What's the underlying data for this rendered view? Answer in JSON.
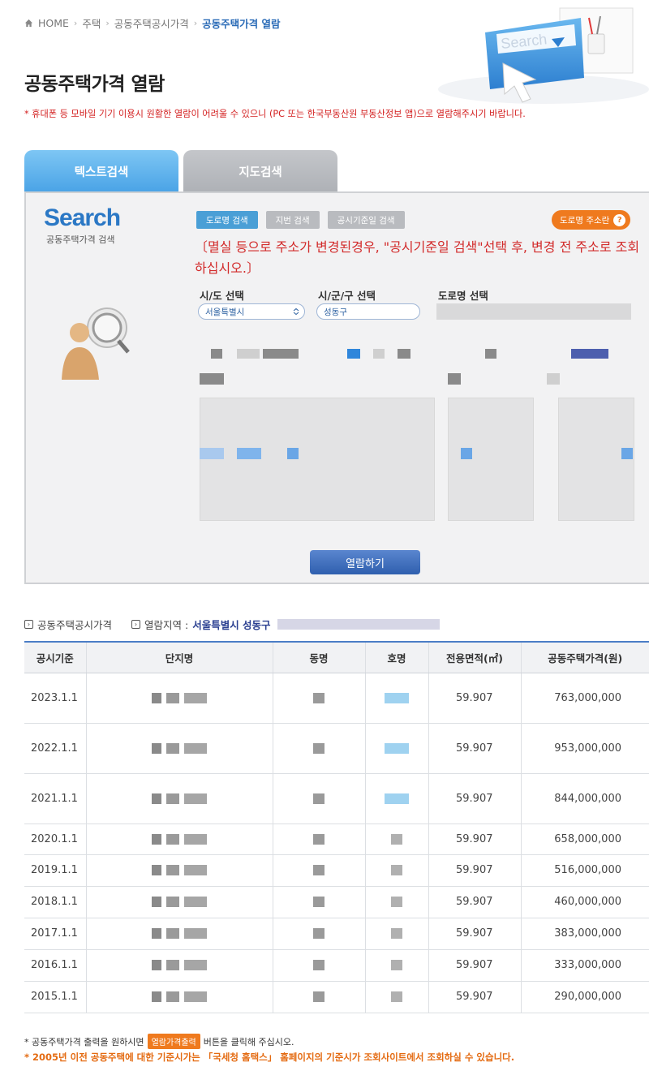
{
  "breadcrumb": {
    "home": "HOME",
    "items": [
      "주택",
      "공동주택공시가격"
    ],
    "current": "공동주택가격 열람"
  },
  "hero": {
    "search_text": "Search"
  },
  "page_title": "공동주택가격 열람",
  "notice": "* 휴대폰 등 모바일 기기 이용시 원활한 열람이 어려울 수 있으니 (PC 또는 한국부동산원 부동산정보 앱)으로 열람해주시기 바랍니다.",
  "tabs": [
    {
      "label": "텍스트검색",
      "active": true
    },
    {
      "label": "지도검색",
      "active": false
    }
  ],
  "search_panel": {
    "logo": "Search",
    "logo_sub": "공동주택가격 검색",
    "mode_buttons": [
      "도로명 검색",
      "지번 검색",
      "공시기준일 검색"
    ],
    "addr_help": "도로명 주소란",
    "note": "〔멸실 등으로 주소가 변경된경우, \"공시기준일 검색\"선택 후, 변경 전 주소로 조회하십시오.〕",
    "labels": {
      "sido": "시/도 선택",
      "sigungu": "시/군/구 선택",
      "road": "도로명 선택"
    },
    "values": {
      "sido": "서울특별시",
      "sigungu": "성동구"
    },
    "view_button": "열람하기"
  },
  "result": {
    "section_label": "공동주택공시가격",
    "region_label": "열람지역 :",
    "region_value": "서울특별시 성동구"
  },
  "table": {
    "headers": [
      "공시기준",
      "단지명",
      "동명",
      "호명",
      "전용면적(㎡)",
      "공동주택가격(원)"
    ],
    "rows": [
      {
        "date": "2023.1.1",
        "area": "59.907",
        "price": "763,000,000"
      },
      {
        "date": "2022.1.1",
        "area": "59.907",
        "price": "953,000,000"
      },
      {
        "date": "2021.1.1",
        "area": "59.907",
        "price": "844,000,000"
      },
      {
        "date": "2020.1.1",
        "area": "59.907",
        "price": "658,000,000"
      },
      {
        "date": "2019.1.1",
        "area": "59.907",
        "price": "516,000,000"
      },
      {
        "date": "2018.1.1",
        "area": "59.907",
        "price": "460,000,000"
      },
      {
        "date": "2017.1.1",
        "area": "59.907",
        "price": "383,000,000"
      },
      {
        "date": "2016.1.1",
        "area": "59.907",
        "price": "333,000,000"
      },
      {
        "date": "2015.1.1",
        "area": "59.907",
        "price": "290,000,000"
      }
    ]
  },
  "footer": {
    "line1_pre": "* 공동주택가격 출력을 원하시면",
    "print_button": "열람가격출력",
    "line1_post": "버튼을 클릭해 주십시오.",
    "line2": "* 2005년 이전 공동주택에 대한 기준시가는 「국세청 홈택스」 홈페이지의 기준시가 조회사이트에서 조회하실 수 있습니다."
  },
  "colors": {
    "accent": "#2b78c5",
    "notice_red": "#d32020",
    "orange": "#ef7a1e"
  }
}
